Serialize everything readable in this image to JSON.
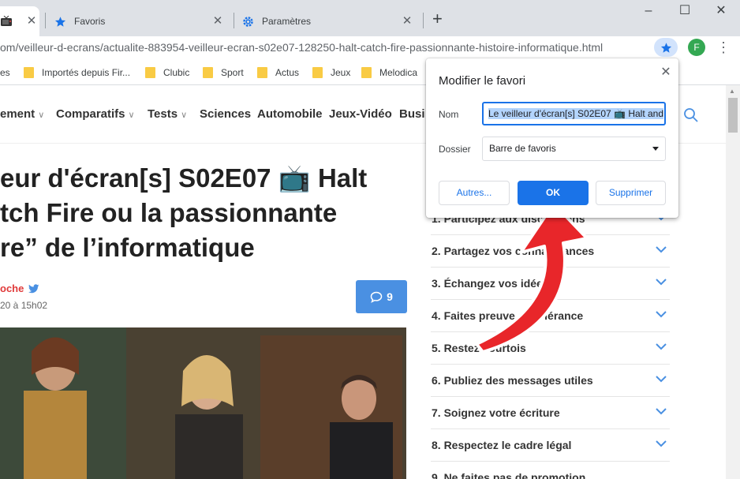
{
  "tabs": [
    {
      "label": "",
      "active": true
    },
    {
      "label": "Favoris",
      "active": false
    },
    {
      "label": "Paramètres",
      "active": false
    }
  ],
  "address": {
    "prefix": "om",
    "path": "/veilleur-d-ecrans/actualite-883954-veilleur-ecran-s02e07-128250-halt-catch-fire-passionnante-histoire-informatique.html"
  },
  "profile_initial": "F",
  "bookmarks": [
    {
      "label": "es",
      "folder": false
    },
    {
      "label": "Importés depuis Fir...",
      "folder": true
    },
    {
      "label": "Clubic",
      "folder": true
    },
    {
      "label": "Sport",
      "folder": true
    },
    {
      "label": "Actus",
      "folder": true
    },
    {
      "label": "Jeux",
      "folder": true
    },
    {
      "label": "Melodica",
      "folder": true
    }
  ],
  "site_nav": [
    "ement",
    "Comparatifs",
    "Tests",
    "Sciences",
    "Automobile",
    "Jeux-Vidéo",
    "Busi"
  ],
  "article": {
    "title_line1": "eur d'écran[s] S02E07 📺 Halt",
    "title_line2": "tch Fire ou la passionnante",
    "title_line3": "re” de l’informatique",
    "author": "oche",
    "date": "20 à 15h02",
    "comment_count": "9"
  },
  "rules": [
    "1. Participez aux discussions",
    "2. Partagez vos connaissances",
    "3. Échangez vos idées",
    "4. Faites preuve de tolérance",
    "5. Restez courtois",
    "6. Publiez des messages utiles",
    "7. Soignez votre écriture",
    "8. Respectez le cadre légal",
    "9. Ne faites pas de promotion"
  ],
  "dialog": {
    "title": "Modifier le favori",
    "name_label": "Nom",
    "name_value": "Le veilleur d'écran[s] S02E07 📺 Halt and",
    "folder_label": "Dossier",
    "folder_value": "Barre de favoris",
    "btn_other": "Autres...",
    "btn_ok": "OK",
    "btn_delete": "Supprimer"
  },
  "colors": {
    "accent_blue": "#1a73e8",
    "comment_blue": "#4a90e2",
    "author_red": "#e03a3a",
    "arrow_red": "#e8262a"
  }
}
